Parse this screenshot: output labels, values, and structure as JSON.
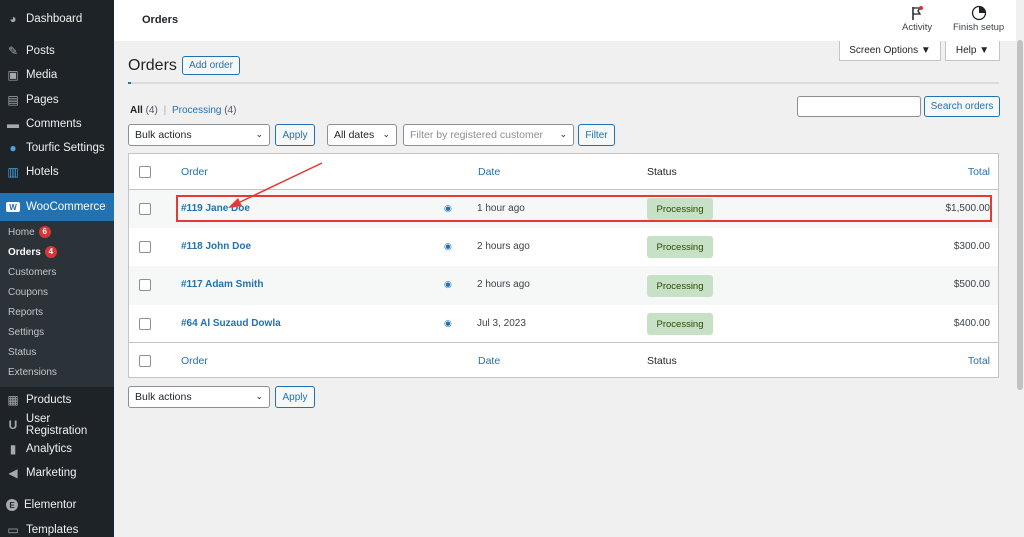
{
  "sidebar": {
    "items": [
      {
        "label": "Dashboard",
        "icon": "dashboard-icon",
        "glyph": "◕"
      },
      {
        "label": "Posts",
        "icon": "pin-icon",
        "glyph": "✎"
      },
      {
        "label": "Media",
        "icon": "media-icon",
        "glyph": "▣"
      },
      {
        "label": "Pages",
        "icon": "pages-icon",
        "glyph": "▤"
      },
      {
        "label": "Comments",
        "icon": "comments-icon",
        "glyph": "▬"
      },
      {
        "label": "Tourfic Settings",
        "icon": "tourfic-icon",
        "glyph": "●"
      },
      {
        "label": "Hotels",
        "icon": "hotels-icon",
        "glyph": "▥"
      },
      {
        "label": "WooCommerce",
        "icon": "woocommerce-icon",
        "glyph": "W"
      },
      {
        "label": "Products",
        "icon": "products-icon",
        "glyph": "▦"
      },
      {
        "label": "User Registration",
        "icon": "user-registration-icon",
        "glyph": "U"
      },
      {
        "label": "Analytics",
        "icon": "analytics-icon",
        "glyph": "▮"
      },
      {
        "label": "Marketing",
        "icon": "marketing-icon",
        "glyph": "◀"
      },
      {
        "label": "Elementor",
        "icon": "elementor-icon",
        "glyph": "E"
      },
      {
        "label": "Templates",
        "icon": "templates-icon",
        "glyph": "▭"
      }
    ],
    "submenu": [
      {
        "label": "Home",
        "badge": "6"
      },
      {
        "label": "Orders",
        "badge": "4"
      },
      {
        "label": "Customers"
      },
      {
        "label": "Coupons"
      },
      {
        "label": "Reports"
      },
      {
        "label": "Settings"
      },
      {
        "label": "Status"
      },
      {
        "label": "Extensions"
      }
    ]
  },
  "header": {
    "title": "Orders",
    "activity": "Activity",
    "finish_setup": "Finish setup",
    "screen_options": "Screen Options ▼",
    "help": "Help ▼"
  },
  "main": {
    "heading": "Orders",
    "add_order": "Add order",
    "filters": {
      "all_label": "All",
      "all_count": "(4)",
      "separator": "|",
      "processing_label": "Processing",
      "processing_count": "(4)"
    },
    "bulk_actions": "Bulk actions",
    "apply": "Apply",
    "all_dates": "All dates",
    "customer_placeholder": "Filter by registered customer",
    "filter": "Filter",
    "search_orders": "Search orders",
    "table": {
      "headers": {
        "order": "Order",
        "date": "Date",
        "status": "Status",
        "total": "Total"
      },
      "rows": [
        {
          "order": "#119 Jane Doe",
          "date": "1 hour ago",
          "status": "Processing",
          "total": "$1,500.00"
        },
        {
          "order": "#118 John Doe",
          "date": "2 hours ago",
          "status": "Processing",
          "total": "$300.00"
        },
        {
          "order": "#117 Adam Smith",
          "date": "2 hours ago",
          "status": "Processing",
          "total": "$500.00"
        },
        {
          "order": "#64 Al Suzaud Dowla",
          "date": "Jul 3, 2023",
          "status": "Processing",
          "total": "$400.00"
        }
      ]
    }
  },
  "colors": {
    "accent": "#2271b1",
    "sidebar_bg": "#1d2327",
    "status_processing_bg": "#c6e1c6",
    "highlight": "#e53935"
  }
}
